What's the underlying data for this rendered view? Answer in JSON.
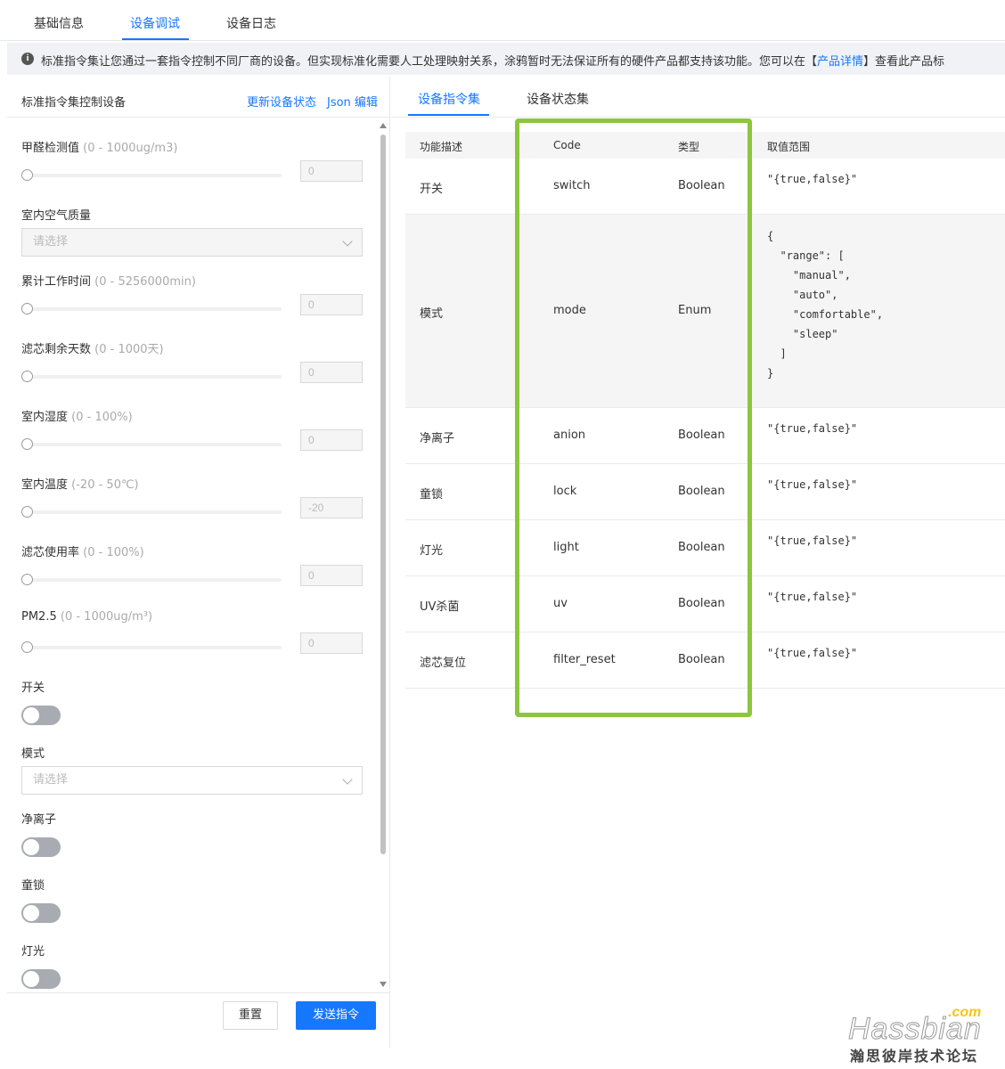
{
  "top_tabs": [
    "基础信息",
    "设备调试",
    "设备日志"
  ],
  "notice": {
    "text_before": "标准指令集让您通过一套指令控制不同厂商的设备。但实现标准化需要人工处理映射关系，涂鸦暂时无法保证所有的硬件产品都支持该功能。您可以在【",
    "link": "产品详情",
    "text_after": "】查看此产品标"
  },
  "left": {
    "title": "标准指令集控制设备",
    "link_refresh": "更新设备状态",
    "link_json": "Json 编辑",
    "fields": [
      {
        "label": "甲醛检测值",
        "range": "(0 - 1000ug/m3)",
        "value": "0"
      },
      {
        "label": "室内空气质量",
        "placeholder": "请选择"
      },
      {
        "label": "累计工作时间",
        "range": "(0 - 5256000min)",
        "value": "0"
      },
      {
        "label": "滤芯剩余天数",
        "range": "(0 - 1000天)",
        "value": "0"
      },
      {
        "label": "室内湿度",
        "range": "(0 - 100%)",
        "value": "0"
      },
      {
        "label": "室内温度",
        "range": "(-20 - 50℃)",
        "value": "-20"
      },
      {
        "label": "滤芯使用率",
        "range": "(0 - 100%)",
        "value": "0"
      },
      {
        "label": "PM2.5",
        "range": "(0 - 1000ug/m³)",
        "value": "0"
      },
      {
        "label": "开关"
      },
      {
        "label": "模式",
        "placeholder": "请选择"
      },
      {
        "label": "净离子"
      },
      {
        "label": "童锁"
      },
      {
        "label": "灯光"
      }
    ],
    "btn_reset": "重置",
    "btn_send": "发送指令"
  },
  "right": {
    "tabs": [
      "设备指令集",
      "设备状态集"
    ],
    "columns": [
      "功能描述",
      "Code",
      "类型",
      "取值范围"
    ],
    "rows": [
      {
        "desc": "开关",
        "code": "switch",
        "type": "Boolean",
        "range": "\"{true,false}\""
      },
      {
        "desc": "模式",
        "code": "mode",
        "type": "Enum",
        "range": "{\n  \"range\": [\n    \"manual\",\n    \"auto\",\n    \"comfortable\",\n    \"sleep\"\n  ]\n}"
      },
      {
        "desc": "净离子",
        "code": "anion",
        "type": "Boolean",
        "range": "\"{true,false}\""
      },
      {
        "desc": "童锁",
        "code": "lock",
        "type": "Boolean",
        "range": "\"{true,false}\""
      },
      {
        "desc": "灯光",
        "code": "light",
        "type": "Boolean",
        "range": "\"{true,false}\""
      },
      {
        "desc": "UV杀菌",
        "code": "uv",
        "type": "Boolean",
        "range": "\"{true,false}\""
      },
      {
        "desc": "滤芯复位",
        "code": "filter_reset",
        "type": "Boolean",
        "range": "\"{true,false}\""
      }
    ]
  },
  "watermark": {
    "com": ".com",
    "main": "Hassbian",
    "sub": "瀚思彼岸技术论坛"
  },
  "colors": {
    "accent": "#1677ff",
    "highlight_box": "#8cc63f"
  }
}
